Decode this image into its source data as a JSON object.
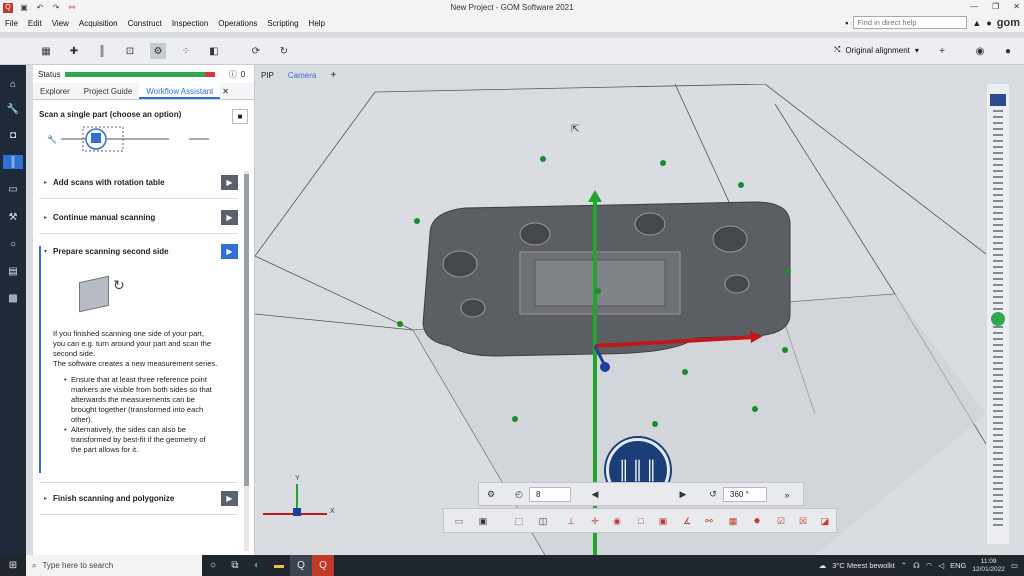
{
  "window": {
    "title": "New Project - GOM Software 2021",
    "min": "—",
    "max": "❐",
    "close": "✕"
  },
  "menu": {
    "items": [
      "File",
      "Edit",
      "View",
      "Acquisition",
      "Construct",
      "Inspection",
      "Operations",
      "Scripting",
      "Help"
    ],
    "help_placeholder": "Find in direct help",
    "brand": "gom"
  },
  "toolbar": {
    "alignment": "Original alignment"
  },
  "panel": {
    "status_label": "Status",
    "status_info": "0",
    "tabs": [
      "Explorer",
      "Project Guide",
      "Workflow Assistant"
    ],
    "heading": "Scan a single part (choose an option)",
    "steps": [
      "Add scans with rotation table",
      "Continue manual scanning",
      "Prepare scanning second side",
      "Finish scanning and polygonize"
    ],
    "desc_1": "If you finished scanning one side of your part, you can e.g. turn around your part and scan the second side.",
    "desc_2": "The software creates a new measurement series.",
    "bullet_1": "Ensure that at least three reference point markers are visible from both sides so that afterwards the measurements can be brought together (transformed into each other).",
    "bullet_2": "Alternatively, the sides can also be transformed by best-fit if the geometry of the part allows for it."
  },
  "view_tabs": [
    "PIP",
    "Camera",
    "+"
  ],
  "viewport": {
    "axis_x": "X",
    "axis_y": "Y"
  },
  "rotation": {
    "steps": "8",
    "angle": "360 °"
  },
  "taskbar": {
    "search": "Type here to search",
    "weather": "3°C  Meest bewolkt",
    "lang": "ENG",
    "time": "11:09",
    "date": "12/01/2022"
  },
  "colors": {
    "accent": "#2f6fd6",
    "nav_bg": "#1e2a3a",
    "disc": "#1a3e78",
    "axis_green": "#22a52b",
    "axis_red": "#c0171d",
    "part": "#5b5e63"
  }
}
